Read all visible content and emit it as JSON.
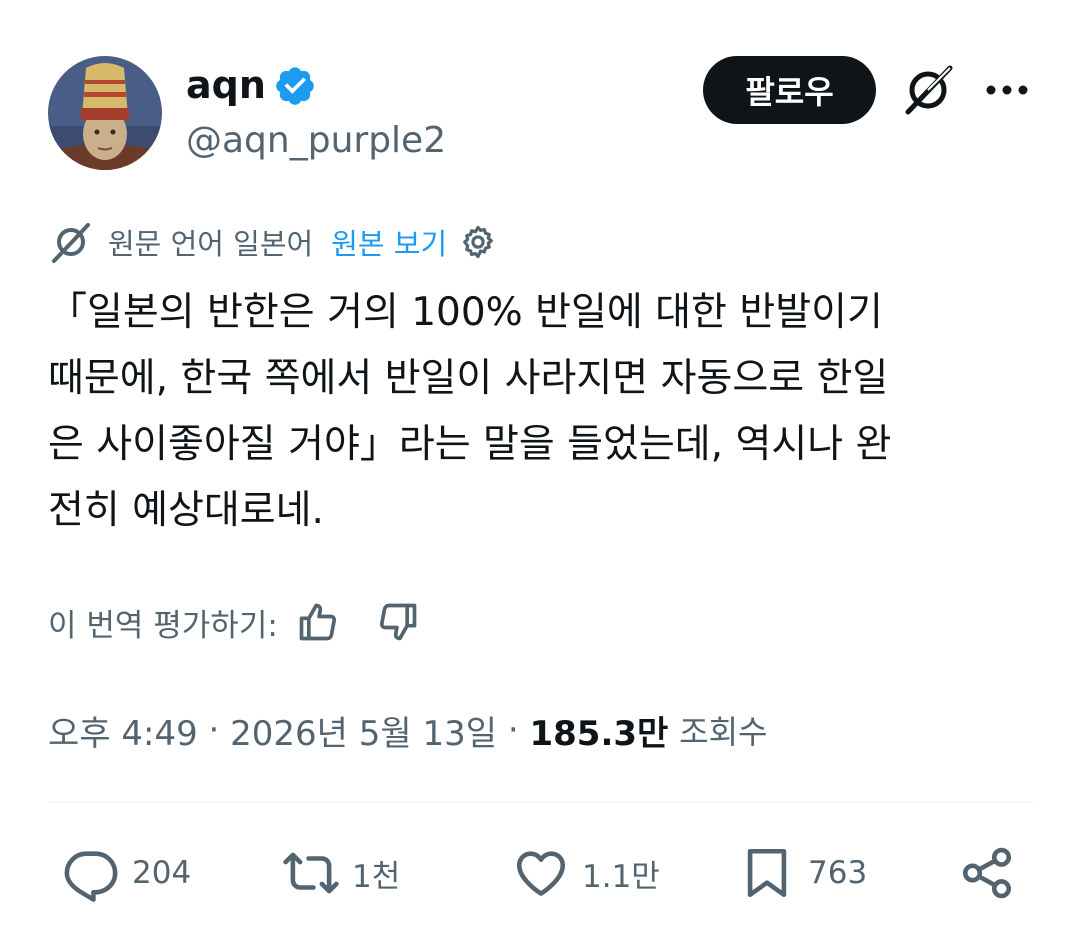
{
  "author": {
    "display_name": "aqn",
    "handle": "@aqn_purple2",
    "avatar_icon": "avatar-portrait",
    "verified": true
  },
  "header": {
    "follow_label": "팔로우",
    "grok_icon": "grok-icon",
    "more_icon": "more-icon"
  },
  "translation": {
    "source_label": "원문 언어 일본어",
    "show_original_label": "원본 보기",
    "settings_icon": "gear-icon"
  },
  "tweet": {
    "text": "「일본의 반한은 거의 100% 반일에 대한 반발이기\n때문에, 한국 쪽에서 반일이 사라지면 자동으로 한일\n은 사이좋아질 거야」라는 말을 들었는데, 역시나 완\n전히 예상대로네."
  },
  "rating": {
    "label": "이 번역 평가하기:"
  },
  "meta": {
    "time": "오후 4:49",
    "separator": " · ",
    "date": "2026년 5월 13일",
    "views_count": "185.3만",
    "views_label": "조회수"
  },
  "actions": {
    "reply_count": "204",
    "retweet_count": "1천",
    "like_count": "1.1만",
    "bookmark_count": "763"
  },
  "colors": {
    "text": "#0f1419",
    "secondary": "#536471",
    "accent": "#1d9bf0",
    "follow_bg": "#0f1419"
  }
}
